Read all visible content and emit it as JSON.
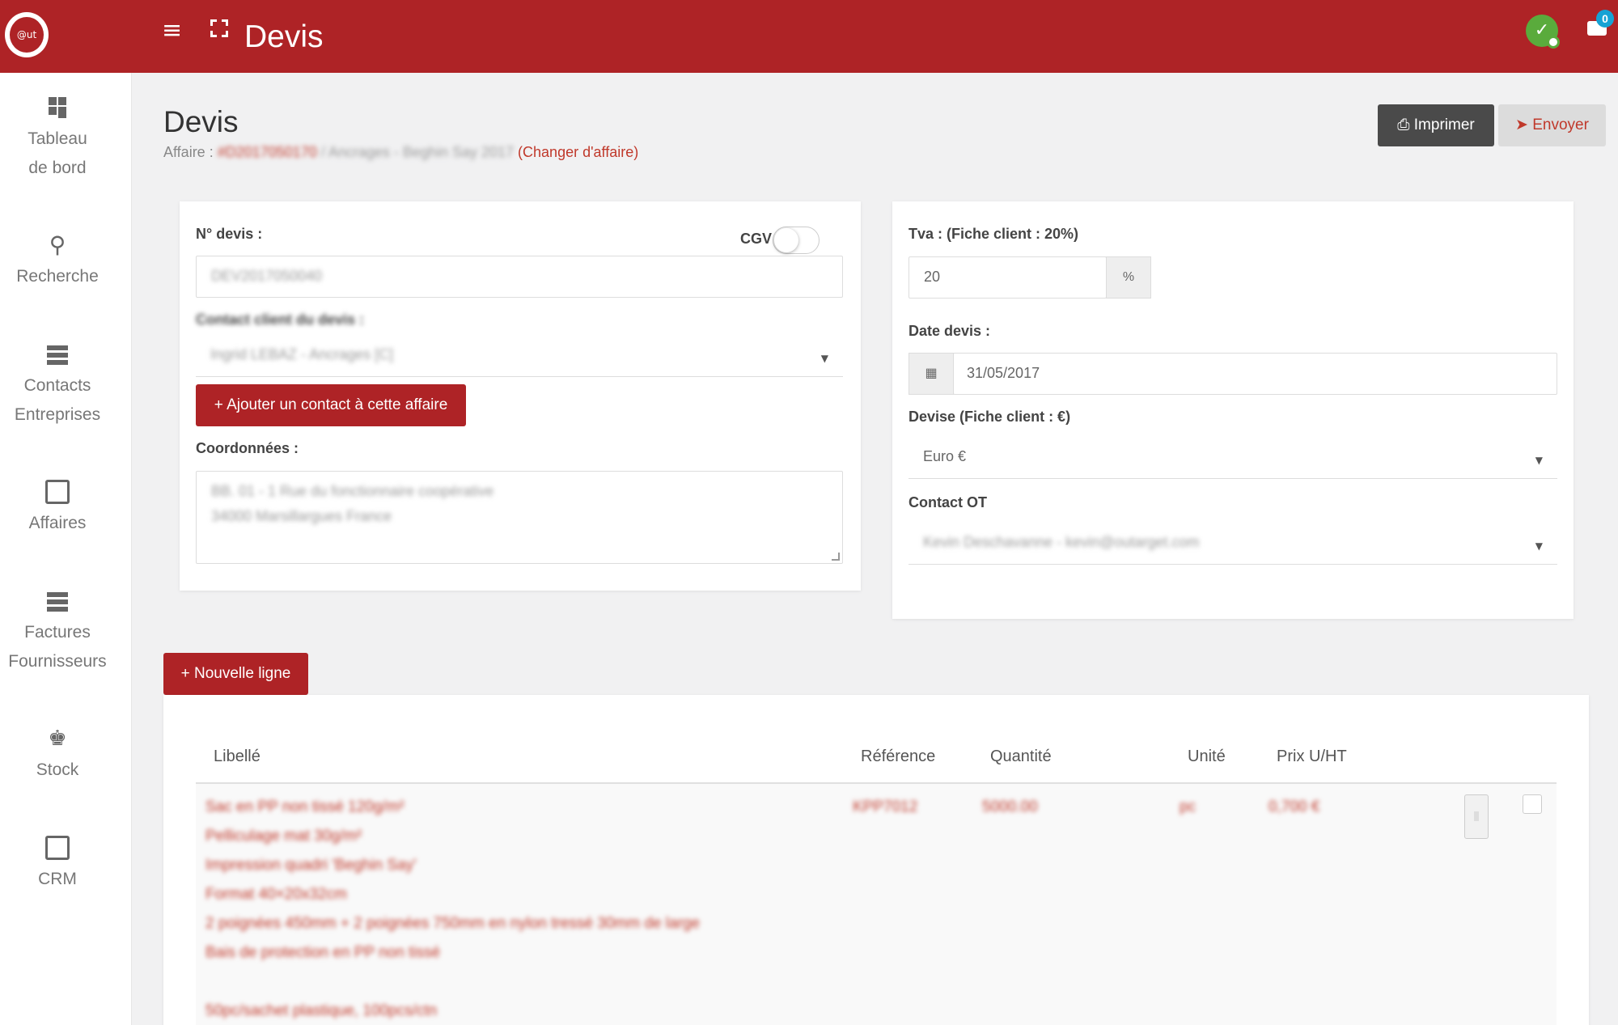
{
  "topbar": {
    "logo_text": "@ut",
    "title": "Devis",
    "notification_count": "0",
    "icons": [
      "hamburger-icon",
      "fullscreen-icon",
      "status-icon",
      "messages-icon"
    ]
  },
  "sidebar": {
    "items": [
      {
        "line1": "Tableau",
        "line2": "de bord",
        "icon": "dashboard-icon"
      },
      {
        "line1": "Recherche",
        "line2": "",
        "icon": "search-icon"
      },
      {
        "line1": "Contacts",
        "line2": "Entreprises",
        "icon": "contacts-icon"
      },
      {
        "line1": "Affaires",
        "line2": "",
        "icon": "deals-icon"
      },
      {
        "line1": "Factures",
        "line2": "Fournisseurs",
        "icon": "invoices-icon"
      },
      {
        "line1": "Stock",
        "line2": "",
        "icon": "stock-icon"
      },
      {
        "line1": "CRM",
        "line2": "",
        "icon": "crm-icon"
      }
    ]
  },
  "header": {
    "title": "Devis",
    "affaire_label": "Affaire :",
    "affaire_id": "#D2017050170",
    "affaire_name": "/ Ancrages - Beghin Say 2017",
    "change_link": "(Changer d'affaire)",
    "print_label": "Imprimer",
    "send_label": "Envoyer"
  },
  "left_form": {
    "devis_label": "N° devis :",
    "devis_value": "DEV2017050040",
    "cgv_label": "CGV",
    "cgv_enabled": false,
    "contact_label": "Contact client du devis :",
    "contact_value": "Ingrid LEBAZ - Ancrages [C]",
    "add_contact_label": "Ajouter un contact à cette affaire",
    "coords_label": "Coordonnées :",
    "coords_line1": "BB. 01 - 1 Rue du fonctionnaire coopérative",
    "coords_line2": "34000 Marsillargues France"
  },
  "right_form": {
    "tva_label": "Tva : (Fiche client : 20%)",
    "tva_value": "20",
    "tva_unit": "%",
    "date_label": "Date devis :",
    "date_value": "31/05/2017",
    "devise_label": "Devise (Fiche client : €)",
    "devise_value": "Euro €",
    "contact_ot_label": "Contact OT",
    "contact_ot_value": "Kevin Deschavanne - kevin@outarget.com"
  },
  "lines": {
    "new_line_label": "+ Nouvelle ligne",
    "columns": [
      "Libellé",
      "Référence",
      "Quantité",
      "Unité",
      "Prix U/HT"
    ],
    "row": {
      "libelle_lines": [
        "Sac en PP non tissé 120g/m²",
        "Pelliculage mat 30g/m²",
        "Impression quadri 'Beghin Say'",
        "Format 40×20x32cm",
        "2 poignées 450mm + 2 poignées 750mm en nylon tressé 30mm de large",
        "Bais de protection en PP non tissé",
        "",
        "50pc/sachet plastique, 100pcs/ctn"
      ],
      "reference": "KPP7012",
      "quantite": "5000.00",
      "unite": "pc",
      "prix": "0,700 €"
    }
  },
  "colors": {
    "brand_red": "#ae2326",
    "dark_button": "#4a4a4a",
    "badge_blue": "#17a2d4",
    "status_green": "#5aab3c"
  }
}
